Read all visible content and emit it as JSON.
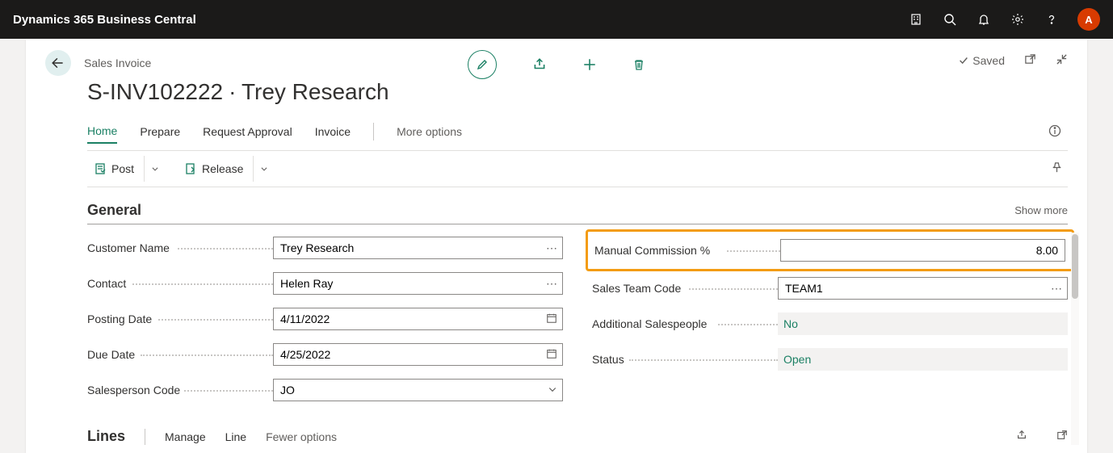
{
  "topbar": {
    "title": "Dynamics 365 Business Central",
    "avatar": "A"
  },
  "crumb": "Sales Invoice",
  "docTitle": "S-INV102222 ∙ Trey Research",
  "saved": "Saved",
  "tabs": {
    "home": "Home",
    "prepare": "Prepare",
    "request": "Request Approval",
    "invoice": "Invoice",
    "more": "More options"
  },
  "toolbar": {
    "post": "Post",
    "release": "Release"
  },
  "section": {
    "title": "General",
    "more": "Show more"
  },
  "fields": {
    "customer": {
      "label": "Customer Name",
      "value": "Trey Research"
    },
    "contact": {
      "label": "Contact",
      "value": "Helen Ray"
    },
    "posting": {
      "label": "Posting Date",
      "value": "4/11/2022"
    },
    "due": {
      "label": "Due Date",
      "value": "4/25/2022"
    },
    "sp": {
      "label": "Salesperson Code",
      "value": "JO"
    },
    "comm": {
      "label": "Manual Commission %",
      "value": "8.00"
    },
    "team": {
      "label": "Sales Team Code",
      "value": "TEAM1"
    },
    "addl": {
      "label": "Additional Salespeople",
      "value": "No"
    },
    "status": {
      "label": "Status",
      "value": "Open"
    }
  },
  "lines": {
    "title": "Lines",
    "manage": "Manage",
    "line": "Line",
    "fewer": "Fewer options"
  }
}
